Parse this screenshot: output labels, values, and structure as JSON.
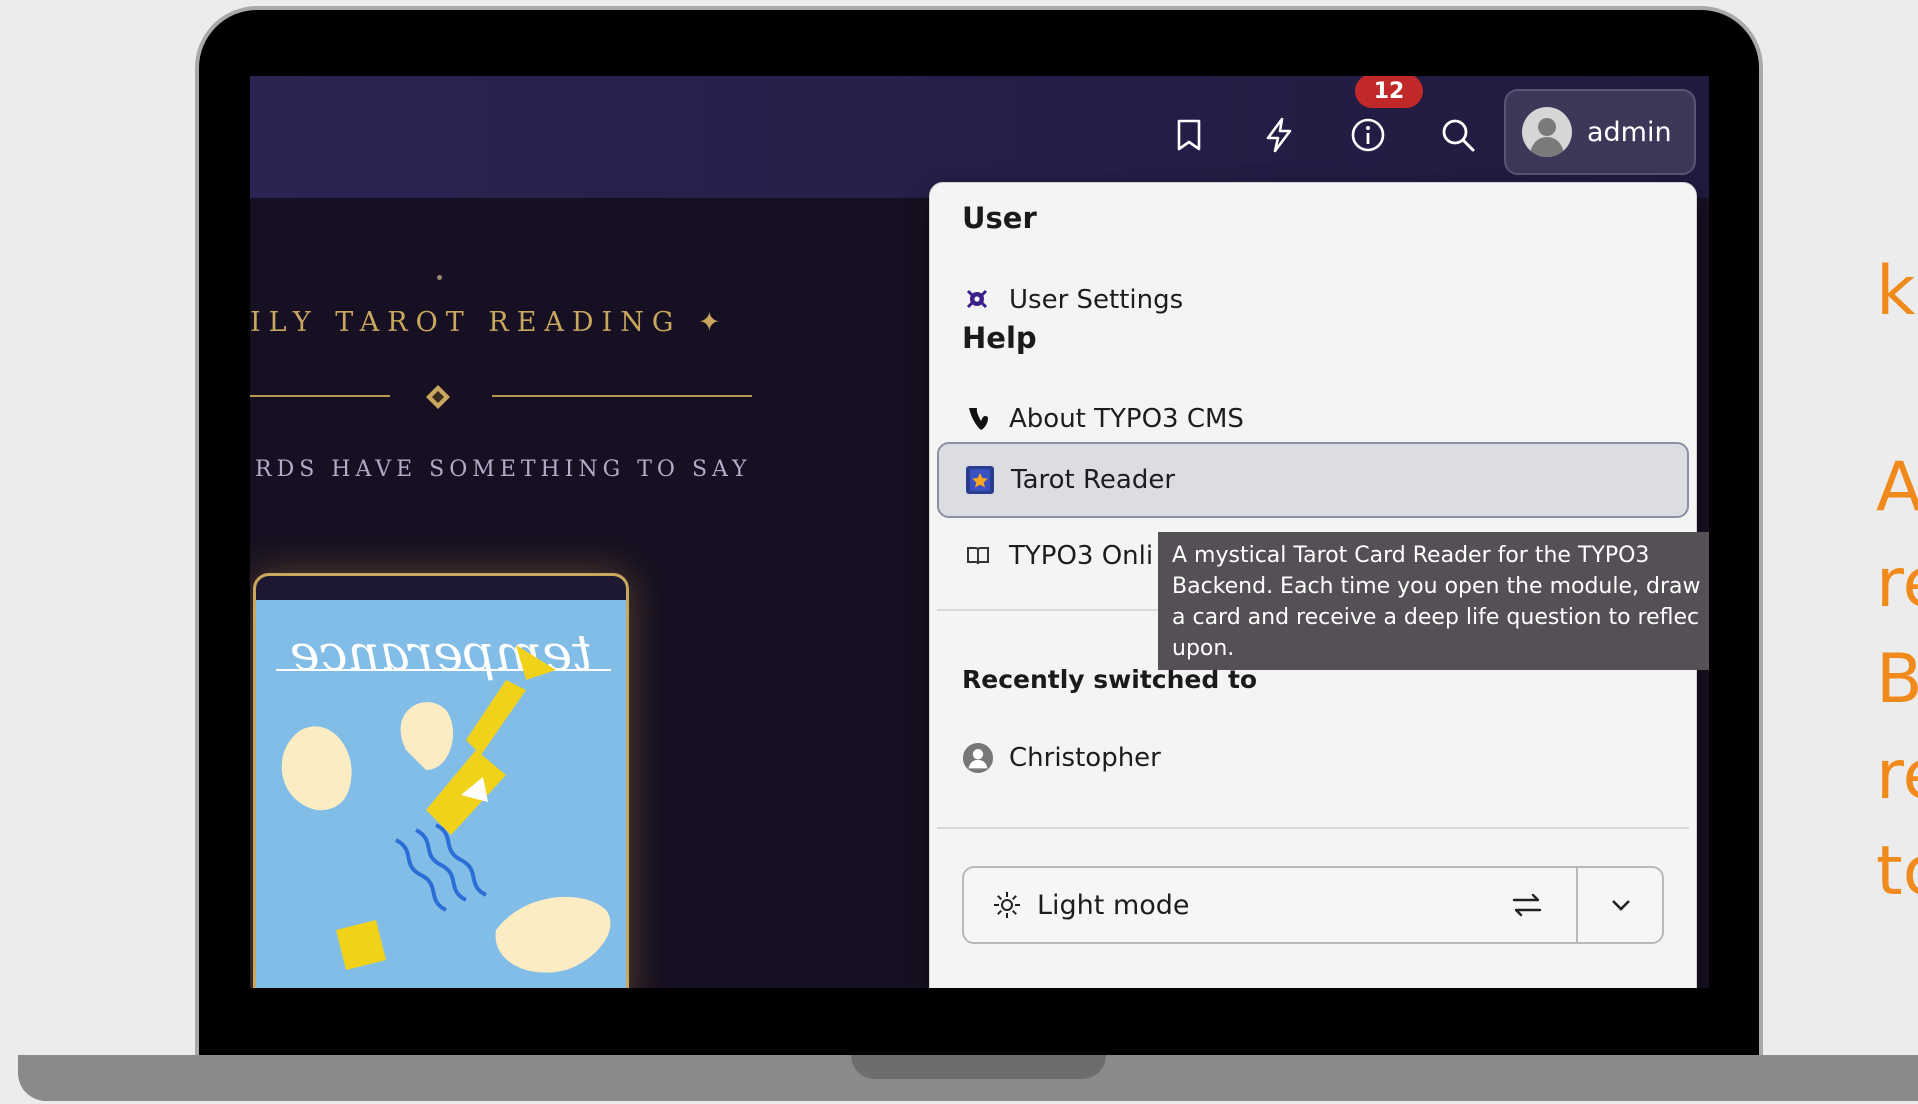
{
  "side_text": [
    "k",
    "A",
    "re",
    "B",
    "re",
    "tc"
  ],
  "topbar": {
    "icons": [
      "bookmark-icon",
      "lightning-icon",
      "info-icon",
      "search-icon"
    ],
    "notification_count": "12",
    "user_label": "admin"
  },
  "tarot": {
    "title": "ILY TAROT READING ✦",
    "subtitle": "RDS HAVE SOMETHING TO SAY",
    "card_script": "temperance"
  },
  "dropdown": {
    "user_heading": "User",
    "user_settings": "User Settings",
    "help_heading": "Help",
    "about": "About TYPO3 CMS",
    "tarot_reader": "Tarot Reader",
    "typo3_online": "TYPO3 Onli",
    "recent_heading": "Recently switched to",
    "recent_user": "Christopher",
    "mode_label": "Light mode"
  },
  "tooltip": {
    "lines": [
      "A mystical Tarot Card Reader for the TYPO3",
      "Backend. Each time you open the module, draw",
      "a card and receive a deep life question to reflec",
      "upon."
    ]
  },
  "colors": {
    "accent": "#f08a1c",
    "topbar": "#2b2352",
    "badge": "#c0282a",
    "gold": "#c9a75f"
  }
}
